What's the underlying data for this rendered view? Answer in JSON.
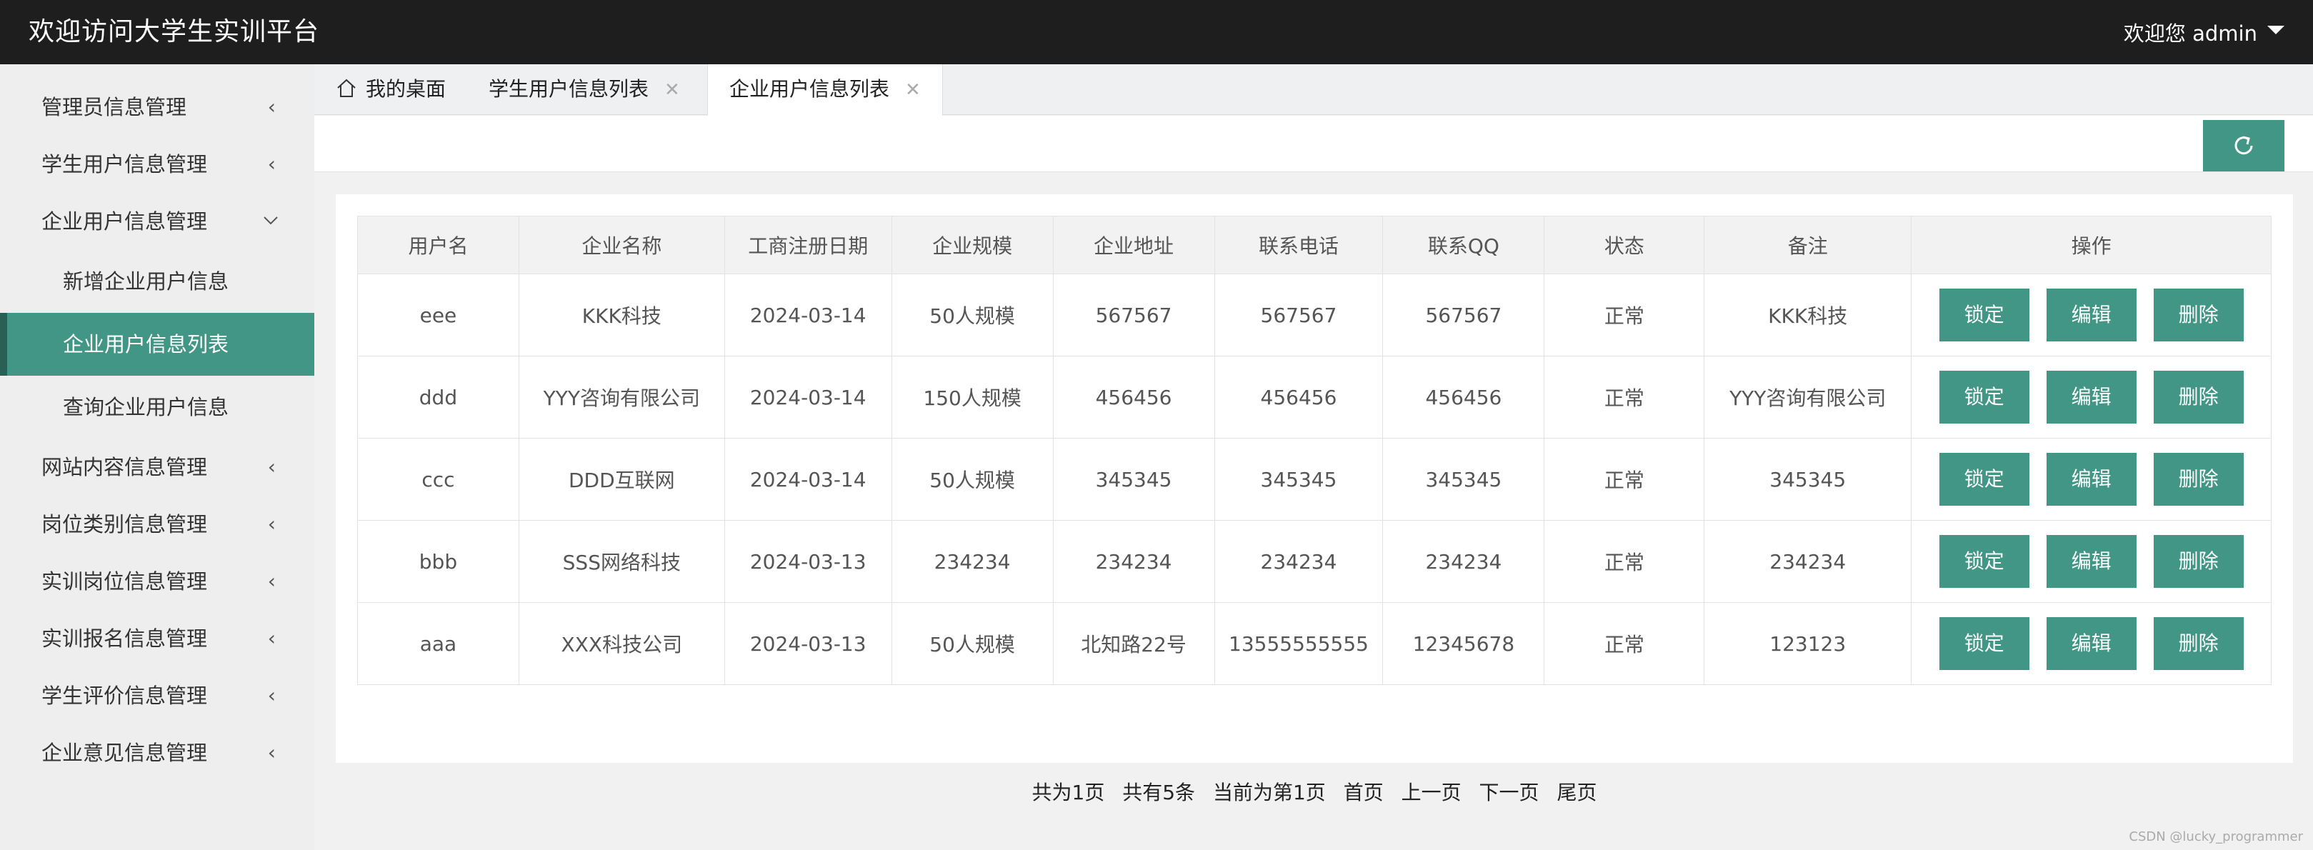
{
  "app": {
    "title": "欢迎访问大学生实训平台",
    "user_menu": "欢迎您 admin"
  },
  "sidebar": {
    "items": [
      {
        "label": "管理员信息管理"
      },
      {
        "label": "学生用户信息管理"
      },
      {
        "label": "企业用户信息管理",
        "expanded": true,
        "children": [
          {
            "label": "新增企业用户信息"
          },
          {
            "label": "企业用户信息列表",
            "active": true
          },
          {
            "label": "查询企业用户信息"
          }
        ]
      },
      {
        "label": "网站内容信息管理"
      },
      {
        "label": "岗位类别信息管理"
      },
      {
        "label": "实训岗位信息管理"
      },
      {
        "label": "实训报名信息管理"
      },
      {
        "label": "学生评价信息管理"
      },
      {
        "label": "企业意见信息管理"
      }
    ]
  },
  "tabs": [
    {
      "label": "我的桌面"
    },
    {
      "label": "学生用户信息列表"
    },
    {
      "label": "企业用户信息列表",
      "active": true
    }
  ],
  "table": {
    "headers": [
      "用户名",
      "企业名称",
      "工商注册日期",
      "企业规模",
      "企业地址",
      "联系电话",
      "联系QQ",
      "状态",
      "备注",
      "操作"
    ],
    "rows": [
      [
        "eee",
        "KKK科技",
        "2024-03-14",
        "50人规模",
        "567567",
        "567567",
        "567567",
        "正常",
        "KKK科技"
      ],
      [
        "ddd",
        "YYY咨询有限公司",
        "2024-03-14",
        "150人规模",
        "456456",
        "456456",
        "456456",
        "正常",
        "YYY咨询有限公司"
      ],
      [
        "ccc",
        "DDD互联网",
        "2024-03-14",
        "50人规模",
        "345345",
        "345345",
        "345345",
        "正常",
        "345345"
      ],
      [
        "bbb",
        "SSS网络科技",
        "2024-03-13",
        "234234",
        "234234",
        "234234",
        "234234",
        "正常",
        "234234"
      ],
      [
        "aaa",
        "XXX科技公司",
        "2024-03-13",
        "50人规模",
        "北知路22号",
        "13555555555",
        "12345678",
        "正常",
        "123123"
      ]
    ],
    "actions": {
      "lock": "锁定",
      "edit": "编辑",
      "delete": "删除"
    }
  },
  "pager": {
    "total_pages": "共为1页",
    "total_items": "共有5条",
    "current": "当前为第1页",
    "first": "首页",
    "prev": "上一页",
    "next": "下一页",
    "last": "尾页"
  },
  "watermark": "CSDN @lucky_programmer",
  "colors": {
    "accent": "#419686",
    "topbar": "#1e1e1e",
    "sidebar": "#eeeeee"
  }
}
